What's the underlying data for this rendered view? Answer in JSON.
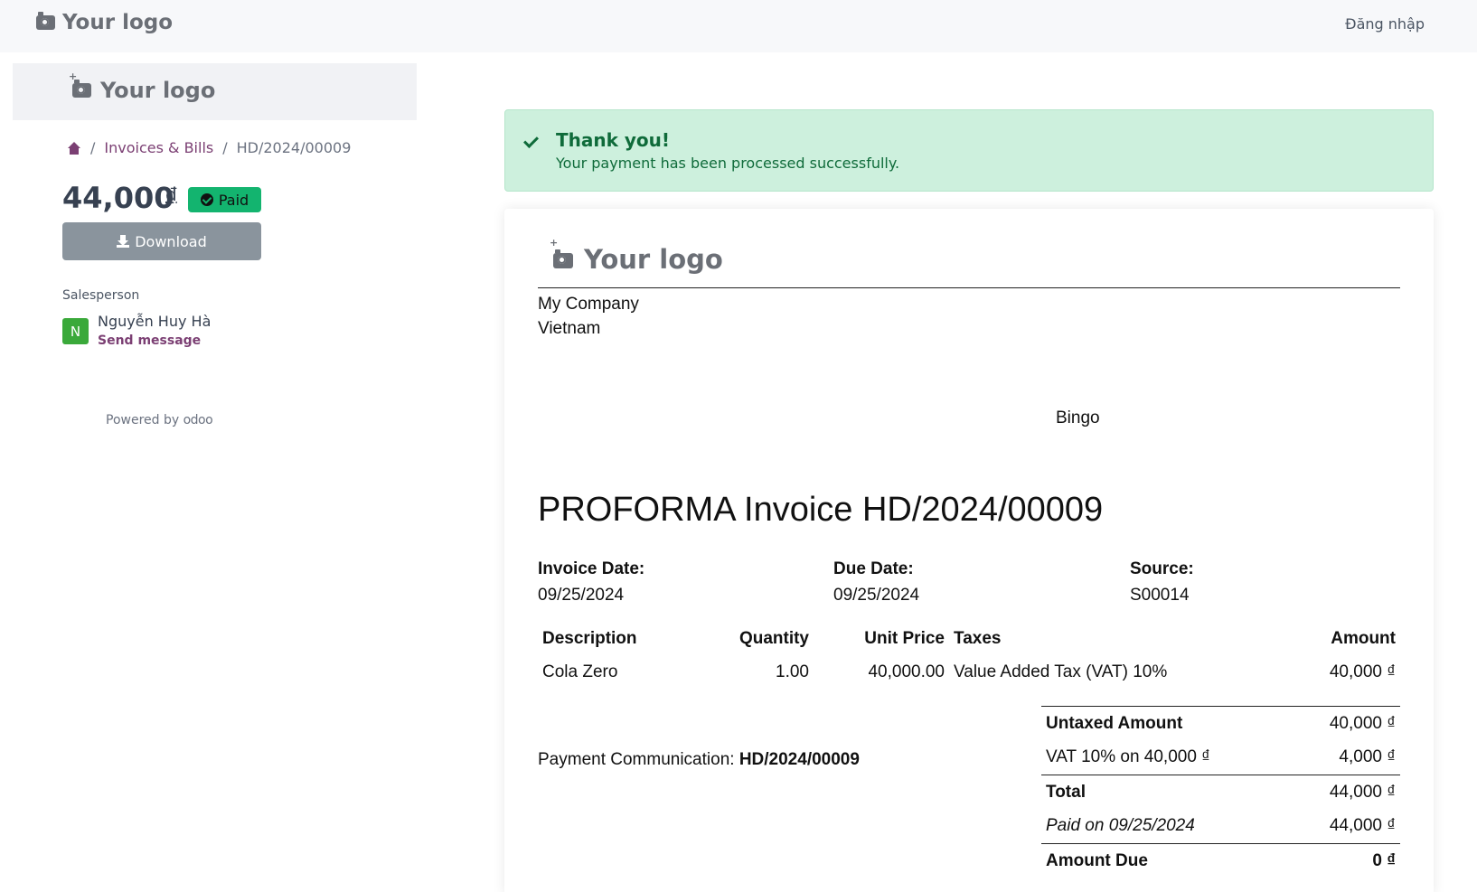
{
  "navbar": {
    "logo_text": "Your logo",
    "login_label": "Đăng nhập"
  },
  "sidebar": {
    "logo_text": "Your logo",
    "breadcrumb": {
      "section": "Invoices & Bills",
      "current": "HD/2024/00009"
    },
    "amount": "44,000",
    "currency": "₫",
    "status_label": "Paid",
    "download_label": "Download",
    "salesperson_label": "Salesperson",
    "salesperson_initial": "N",
    "salesperson_name": "Nguyễn Huy Hà",
    "send_message_label": "Send message",
    "powered_by_label": "Powered by",
    "powered_by_brand": "odoo"
  },
  "alert": {
    "title": "Thank you!",
    "message": "Your payment has been processed successfully."
  },
  "invoice": {
    "logo_text": "Your logo",
    "company_name": "My Company",
    "company_country": "Vietnam",
    "customer": "Bingo",
    "title": "PROFORMA Invoice HD/2024/00009",
    "invoice_date_label": "Invoice Date:",
    "invoice_date": "09/25/2024",
    "due_date_label": "Due Date:",
    "due_date": "09/25/2024",
    "source_label": "Source:",
    "source": "S00014",
    "columns": [
      "Description",
      "Quantity",
      "Unit Price",
      "Taxes",
      "Amount"
    ],
    "lines": [
      {
        "description": "Cola Zero",
        "quantity": "1.00",
        "unit_price": "40,000.00",
        "taxes": "Value Added Tax (VAT) 10%",
        "amount": "40,000 ₫"
      }
    ],
    "payment_comm_label": "Payment Communication:",
    "payment_comm_value": "HD/2024/00009",
    "totals": {
      "untaxed_label": "Untaxed Amount",
      "untaxed_value": "40,000 ₫",
      "vat_label": "VAT 10% on 40,000 ₫",
      "vat_value": "4,000 ₫",
      "total_label": "Total",
      "total_value": "44,000 ₫",
      "paid_label": "Paid on 09/25/2024",
      "paid_value": "44,000 ₫",
      "due_label": "Amount Due",
      "due_value": "0 ₫"
    }
  },
  "colors": {
    "brand": "#7b3f73",
    "success": "#13b46f",
    "alert_bg": "#cdf0dd",
    "alert_text": "#0f6b3a",
    "button_gray": "#8a949d"
  }
}
